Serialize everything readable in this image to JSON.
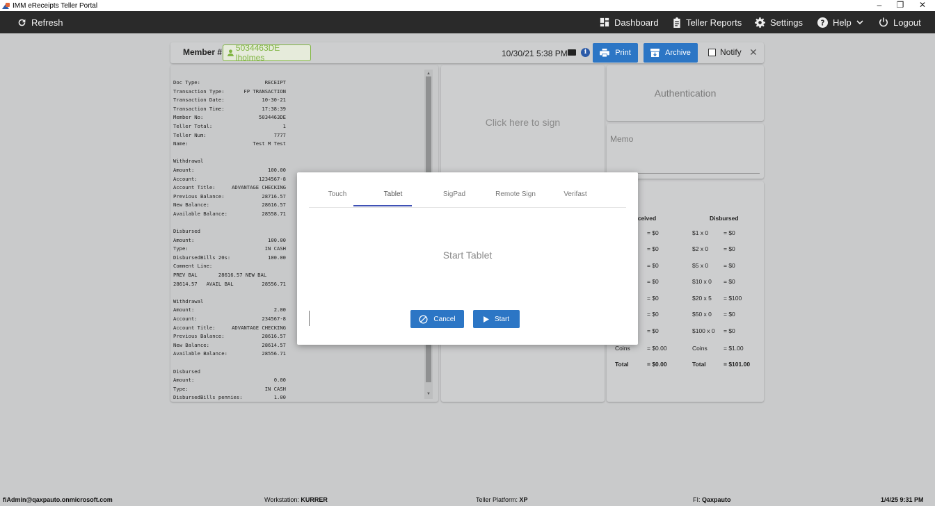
{
  "window": {
    "title": "IMM eReceipts Teller Portal",
    "controls": [
      "–",
      "❐",
      "✕"
    ]
  },
  "navbar": {
    "refresh": "Refresh",
    "dashboard": "Dashboard",
    "teller_reports": "Teller Reports",
    "settings": "Settings",
    "help": "Help",
    "logout": "Logout"
  },
  "member": {
    "label": "Member #:",
    "value": "5034463DE lholmes",
    "datetime": "10/30/21 5:38 PM",
    "print": "Print",
    "archive": "Archive",
    "notify": "Notify",
    "close": "✕"
  },
  "receipt": {
    "lines": [
      [
        "Doc Type:",
        "RECEIPT"
      ],
      [
        "Transaction Type:",
        "FP TRANSACTION"
      ],
      [
        "Transaction Date:",
        "10-30-21"
      ],
      [
        "Transaction Time:",
        "17:38:39"
      ],
      [
        "Member No:",
        "5034463DE"
      ],
      [
        "Teller Total:",
        "1"
      ],
      [
        "Teller Num:",
        "7777"
      ],
      [
        "Name:",
        "Test M Test"
      ],
      [
        "",
        ""
      ],
      [
        "Withdrawal",
        ""
      ],
      [
        "Amount:",
        "100.00"
      ],
      [
        "Account:",
        "1234567-8"
      ],
      [
        "Account Title:",
        "ADVANTAGE CHECKING"
      ],
      [
        "Previous Balance:",
        "28716.57"
      ],
      [
        "New Balance:",
        "28616.57"
      ],
      [
        "Available Balance:",
        "28558.71"
      ],
      [
        "",
        ""
      ],
      [
        "Disbursed",
        ""
      ],
      [
        "Amount:",
        "100.00"
      ],
      [
        "Type:",
        "IN CASH"
      ],
      [
        "DisbursedBills 20s:",
        "100.00"
      ],
      [
        "Comment Line:",
        ""
      ],
      [
        "PREV BAL       28616.57 NEW BAL",
        ""
      ],
      [
        "28614.57   AVAIL BAL",
        "28556.71"
      ],
      [
        "",
        ""
      ],
      [
        "Withdrawal",
        ""
      ],
      [
        "Amount:",
        "2.00"
      ],
      [
        "Account:",
        "234567-8"
      ],
      [
        "Account Title:",
        "ADVANTAGE CHECKING"
      ],
      [
        "Previous Balance:",
        "28616.57"
      ],
      [
        "New Balance:",
        "28614.57"
      ],
      [
        "Available Balance:",
        "28556.71"
      ],
      [
        "",
        ""
      ],
      [
        "Disbursed",
        ""
      ],
      [
        "Amount:",
        "0.00"
      ],
      [
        "Type:",
        "IN CASH"
      ],
      [
        "DisbursedBills pennies:",
        "1.00"
      ]
    ]
  },
  "sign": {
    "prompt": "Click here to sign"
  },
  "auth": {
    "title": "Authentication"
  },
  "memo": {
    "label": "Memo"
  },
  "cash": {
    "received_header": "eceived",
    "disbursed_header": "Disbursed",
    "received_rows": [
      "= $0",
      "= $0",
      "= $0",
      "= $0",
      "= $0",
      "= $0",
      "= $0"
    ],
    "disbursed_rows": [
      [
        "$1 x 0",
        "= $0"
      ],
      [
        "$2 x 0",
        "= $0"
      ],
      [
        "$5 x 0",
        "= $0"
      ],
      [
        "$10 x 0",
        "= $0"
      ],
      [
        "$20 x 5",
        "= $100"
      ],
      [
        "$50 x 0",
        "= $0"
      ],
      [
        "$100 x 0",
        "= $0"
      ]
    ],
    "coins_label": "Coins",
    "coins_received": "= $0.00",
    "coins_disbursed": "= $1.00",
    "total_label": "Total",
    "total_received": "= $0.00",
    "total_disbursed": "= $101.00"
  },
  "modal": {
    "tabs": [
      "Touch",
      "Tablet",
      "SigPad",
      "Remote Sign",
      "Verifast"
    ],
    "active_tab": "Tablet",
    "body": "Start Tablet",
    "cancel": "Cancel",
    "start": "Start"
  },
  "status": {
    "user": "fiAdmin@qaxpauto.onmicrosoft.com",
    "workstation_label": "Workstation:",
    "workstation": "KURRER",
    "platform_label": "Teller Platform:",
    "platform": "XP",
    "fi_label": "FI:",
    "fi": "Qaxpauto",
    "datetime": "1/4/25 9:31 PM"
  },
  "colors": {
    "navbar": "#2a2a2a",
    "accent": "#2c76c5",
    "member_green": "#7fb441",
    "tab_underline": "#3f51b5"
  }
}
